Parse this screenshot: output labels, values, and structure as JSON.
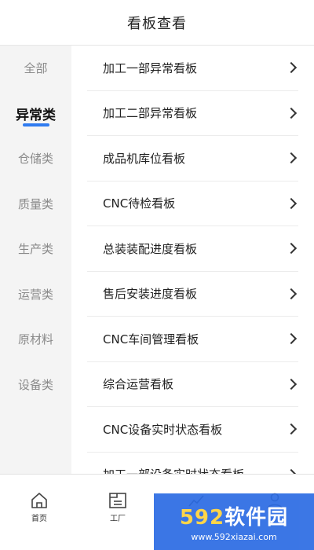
{
  "header": {
    "title": "看板查看"
  },
  "sidebar": {
    "items": [
      {
        "label": "全部",
        "active": false
      },
      {
        "label": "异常类",
        "active": true
      },
      {
        "label": "仓储类",
        "active": false
      },
      {
        "label": "质量类",
        "active": false
      },
      {
        "label": "生产类",
        "active": false
      },
      {
        "label": "运营类",
        "active": false
      },
      {
        "label": "原材料",
        "active": false
      },
      {
        "label": "设备类",
        "active": false
      }
    ],
    "active_color": "#2f7bf0"
  },
  "list": {
    "items": [
      {
        "label": "加工一部异常看板"
      },
      {
        "label": "加工二部异常看板"
      },
      {
        "label": "成品机库位看板"
      },
      {
        "label": "CNC待检看板"
      },
      {
        "label": "总装装配进度看板"
      },
      {
        "label": "售后安装进度看板"
      },
      {
        "label": "CNC车间管理看板"
      },
      {
        "label": "综合运营看板"
      },
      {
        "label": "CNC设备实时状态看板"
      },
      {
        "label": "加工一部设备实时状态看板"
      }
    ]
  },
  "tabbar": {
    "tabs": [
      {
        "label": "首页",
        "icon": "home-icon"
      },
      {
        "label": "工厂",
        "icon": "factory-icon"
      },
      {
        "label": "",
        "icon": "chart-icon"
      },
      {
        "label": "",
        "icon": "user-icon"
      }
    ]
  },
  "watermark": {
    "main_num": "592",
    "main_text": "软件园",
    "url": "www.592xiazai.com"
  }
}
